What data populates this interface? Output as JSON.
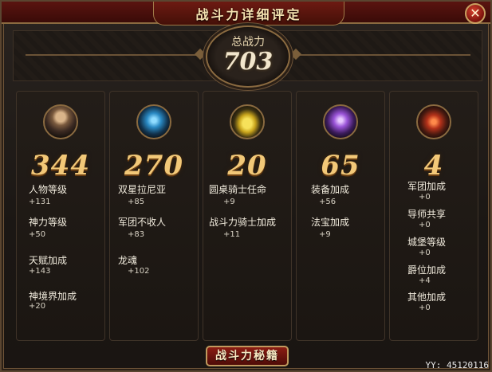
{
  "window": {
    "title": "战斗力详细评定",
    "close_glyph": "✕"
  },
  "total": {
    "label": "总战力",
    "value": "703"
  },
  "panels": [
    {
      "icon": "hero-portrait-icon",
      "value": "344",
      "stats": [
        {
          "label": "人物等级",
          "value": "+131"
        },
        {
          "label": "神力等级",
          "value": "+50"
        },
        {
          "label": "天赋加成",
          "value": "+143"
        },
        {
          "label": "神境界加成",
          "value": "+20"
        }
      ]
    },
    {
      "icon": "dragon-icon",
      "value": "270",
      "stats": [
        {
          "label": "双星拉尼亚",
          "value": "+85"
        },
        {
          "label": "军团不收人",
          "value": "+83"
        },
        {
          "label": "龙魂",
          "value": "+102"
        }
      ]
    },
    {
      "icon": "knight-helmet-icon",
      "value": "20",
      "stats": [
        {
          "label": "圆桌骑士任命",
          "value": "+9"
        },
        {
          "label": "战斗力骑士加成",
          "value": "+11"
        }
      ]
    },
    {
      "icon": "equipment-icon",
      "value": "65",
      "stats": [
        {
          "label": "装备加成",
          "value": "+56"
        },
        {
          "label": "法宝加成",
          "value": "+9"
        }
      ]
    },
    {
      "icon": "shield-crest-icon",
      "value": "4",
      "stats": [
        {
          "label": "军团加成",
          "value": "+0"
        },
        {
          "label": "导师共享",
          "value": "+0"
        },
        {
          "label": "城堡等级",
          "value": "+0"
        },
        {
          "label": "爵位加成",
          "value": "+4"
        },
        {
          "label": "其他加成",
          "value": "+0"
        }
      ]
    }
  ],
  "button": {
    "label": "战斗力秘籍"
  },
  "watermark": "YY: 45120116"
}
